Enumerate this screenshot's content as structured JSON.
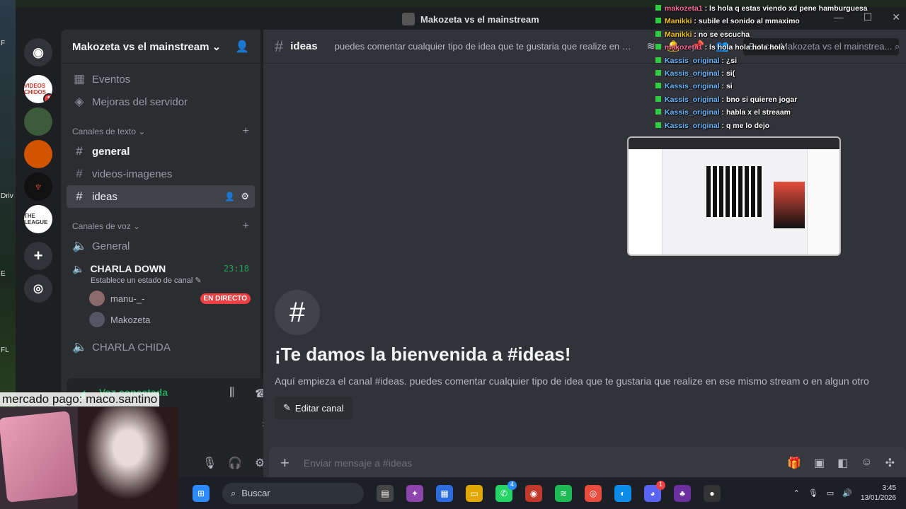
{
  "window": {
    "title": "Makozeta vs el mainstream"
  },
  "desktop": {
    "labels": [
      "F",
      "Driv",
      "E",
      "FL"
    ]
  },
  "guilds": [
    {
      "name": "VIDEOS CHIDOS",
      "badge": "1",
      "color": "#c0392b"
    },
    {
      "name": "server-2",
      "badge": "",
      "color": "#3d5a3a"
    },
    {
      "name": "server-3",
      "badge": "",
      "color": "#d35400"
    },
    {
      "name": "server-4",
      "badge": "",
      "color": "#111111"
    },
    {
      "name": "THE LEAGUE",
      "badge": "",
      "color": "#ffffff"
    }
  ],
  "server": {
    "name": "Makozeta vs el mainstream"
  },
  "sidebar": {
    "top_items": [
      {
        "label": "Eventos",
        "icon": "calendar-icon"
      },
      {
        "label": "Mejoras del servidor",
        "icon": "boost-icon"
      }
    ],
    "text_category": "Canales de texto",
    "text_channels": [
      {
        "label": "general",
        "state": "unread"
      },
      {
        "label": "videos-imagenes",
        "state": "normal"
      },
      {
        "label": "ideas",
        "state": "active"
      }
    ],
    "voice_category": "Canales de voz",
    "voice_general": "General",
    "charla_down": {
      "label": "CHARLA DOWN",
      "time": "23:18",
      "status": "Establece un estado de canal"
    },
    "voice_users": [
      {
        "name": "manu-_-",
        "live": "EN DIRECTO"
      },
      {
        "name": "Makozeta",
        "live": ""
      }
    ],
    "charla_chida": "CHARLA CHIDA"
  },
  "voice_panel": {
    "status": "Voz conectada"
  },
  "overlay_text": "mercado pago: maco.santino",
  "channel": {
    "name": "ideas",
    "topic": "puedes comentar cualquier tipo de idea que te gustaria que realize en es...",
    "search_placeholder": "Buscar Makozeta vs el mainstrea..."
  },
  "welcome": {
    "title": "¡Te damos la bienvenida a #ideas!",
    "desc": "Aquí empieza el canal #ideas. puedes comentar cualquier tipo de idea que te gustaria que realize en ese mismo stream o en algun otro",
    "edit_label": "Editar canal"
  },
  "composer": {
    "placeholder": "Enviar mensaje a #ideas"
  },
  "chat_overlay": [
    {
      "user": "makozeta1",
      "msg": "ls hola q estas viendo xd pene hamburguesa",
      "color": "#ff6b9a"
    },
    {
      "user": "Manikki",
      "msg": "subile el sonido al mmaximo",
      "color": "#f1c40f"
    },
    {
      "user": "Manikki",
      "msg": "no se escucha",
      "color": "#f1c40f"
    },
    {
      "user": "makozeta1",
      "msg": "ls hola hola hola hola",
      "color": "#ff6b9a"
    },
    {
      "user": "Kassis_original",
      "msg": "¿si",
      "color": "#6ab7ff"
    },
    {
      "user": "Kassis_original",
      "msg": "si(",
      "color": "#6ab7ff"
    },
    {
      "user": "Kassis_original",
      "msg": "si",
      "color": "#6ab7ff"
    },
    {
      "user": "Kassis_original",
      "msg": "bno si quieren jogar",
      "color": "#6ab7ff"
    },
    {
      "user": "Kassis_original",
      "msg": "habla x el streaam",
      "color": "#6ab7ff"
    },
    {
      "user": "Kassis_original",
      "msg": "q me lo dejo",
      "color": "#6ab7ff"
    }
  ],
  "stream_preview": {
    "logo_text": "ANTINOMY"
  },
  "taskbar": {
    "search_label": "Buscar",
    "whatsapp_badge": "4",
    "discord_badge": "1",
    "time": "3:45",
    "date": "13/01/2026"
  }
}
